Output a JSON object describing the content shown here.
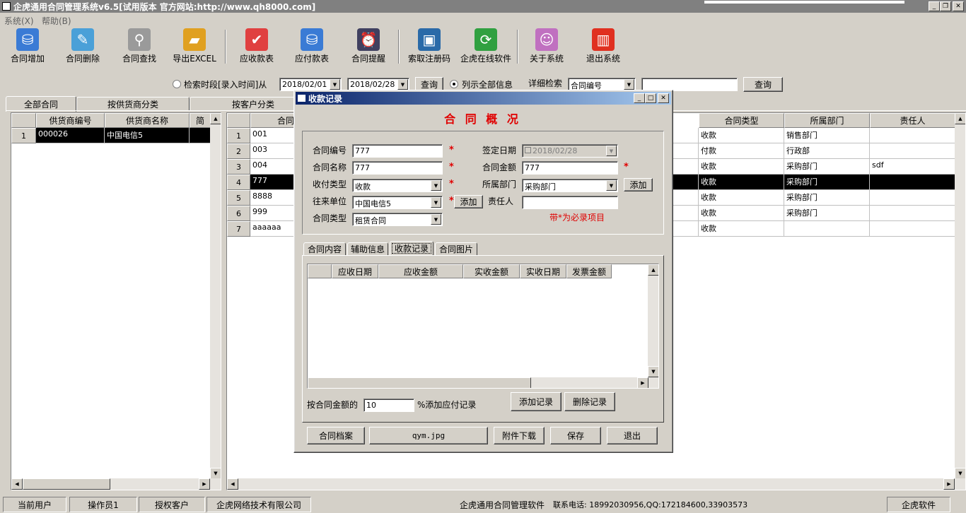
{
  "window": {
    "title": "企虎通用合同管理系统v6.5[试用版本 官方网站:http://www.qh8000.com]"
  },
  "menu": [
    "系统(X)",
    "帮助(B)"
  ],
  "toolbar": [
    {
      "label": "合同增加",
      "icon": "database-add-icon",
      "color": "#3a7bd5"
    },
    {
      "label": "合同删除",
      "icon": "document-edit-icon",
      "color": "#4aa0d8"
    },
    {
      "label": "合同查找",
      "icon": "magnifier-icon",
      "color": "#9a9a9a"
    },
    {
      "label": "导出EXCEL",
      "icon": "folder-export-icon",
      "color": "#e0a020"
    },
    {
      "label": "应收款表",
      "icon": "check-circle-icon",
      "color": "#e04040"
    },
    {
      "label": "应付款表",
      "icon": "database-pay-icon",
      "color": "#3a7bd5"
    },
    {
      "label": "合同提醒",
      "icon": "alarm-bug-icon",
      "color": "#404060"
    },
    {
      "label": "索取注册码",
      "icon": "monitor-key-icon",
      "color": "#2a6aa8"
    },
    {
      "label": "企虎在线软件",
      "icon": "refresh-icon",
      "color": "#30a040"
    },
    {
      "label": "关于系统",
      "icon": "finder-icon",
      "color": "#c070c0"
    },
    {
      "label": "退出系统",
      "icon": "cube-exit-icon",
      "color": "#e03020"
    }
  ],
  "filter": {
    "range_label": "检索时段[录入时间]从",
    "date_from": "2018/02/01",
    "date_to": "2018/02/28",
    "query_label": "查询",
    "list_all_label": "列示全部信息",
    "detail_label": "详细检索",
    "detail_field": "合同编号",
    "detail_value": "",
    "query2_label": "查询"
  },
  "tabs": [
    "全部合同",
    "按供货商分类",
    "按客户分类"
  ],
  "supplier_grid": {
    "headers": [
      "供货商编号",
      "供货商名称",
      "简"
    ],
    "rows": [
      {
        "num": "1",
        "code": "000026",
        "name": "中国电信5",
        "short": ""
      }
    ]
  },
  "contract_grid": {
    "headers": [
      "合同",
      "合同类型",
      "所属部门",
      "责任人"
    ],
    "rows": [
      {
        "num": "1",
        "code": "001",
        "type": "收款",
        "dept": "销售部门",
        "person": ""
      },
      {
        "num": "2",
        "code": "003",
        "type": "付款",
        "dept": "行政部",
        "person": ""
      },
      {
        "num": "3",
        "code": "004",
        "type": "收款",
        "dept": "采购部门",
        "person": "sdf"
      },
      {
        "num": "4",
        "code": "777",
        "type": "收款",
        "dept": "采购部门",
        "person": ""
      },
      {
        "num": "5",
        "code": "8888",
        "type": "收款",
        "dept": "采购部门",
        "person": ""
      },
      {
        "num": "6",
        "code": "999",
        "type": "收款",
        "dept": "采购部门",
        "person": ""
      },
      {
        "num": "7",
        "code": "aaaaaa",
        "type": "收款",
        "dept": "",
        "person": ""
      }
    ]
  },
  "dialog": {
    "title": "收款记录",
    "heading": "合 同 概 况",
    "fields": {
      "code_label": "合同编号",
      "code": "777",
      "name_label": "合同名称",
      "name": "777",
      "paytype_label": "收付类型",
      "paytype": "收款",
      "partner_label": "往来单位",
      "partner": "中国电信5",
      "ctype_label": "合同类型",
      "ctype": "租赁合同",
      "sign_label": "签定日期",
      "sign": "2018/02/28",
      "amount_label": "合同金额",
      "amount": "777",
      "dept_label": "所属部门",
      "dept": "采购部门",
      "person_label": "责任人",
      "person": "",
      "add_label": "添加",
      "req_star": "*",
      "required_note": "带*为必录项目"
    },
    "subtabs": [
      "合同内容",
      "辅助信息",
      "收款记录",
      "合同图片"
    ],
    "record_headers": [
      "应收日期",
      "应收金额",
      "实收金额",
      "实收日期",
      "发票金额"
    ],
    "percent_label": "按合同金额的",
    "percent_value": "10",
    "percent_suffix": "%添加应付记录",
    "add_record": "添加记录",
    "del_record": "删除记录",
    "archive_btn": "合同档案",
    "file_btn": "qym.jpg",
    "download_btn": "附件下载",
    "save_btn": "保存",
    "exit_btn": "退出"
  },
  "statusbar": {
    "current_user_label": "当前用户",
    "operator": "操作员1",
    "licensed_label": "授权客户",
    "company": "企虎网络技术有限公司",
    "product": "企虎通用合同管理软件",
    "contact": "联系电话: 18992030956,QQ:172184600,33903573",
    "brand": "企虎软件"
  }
}
